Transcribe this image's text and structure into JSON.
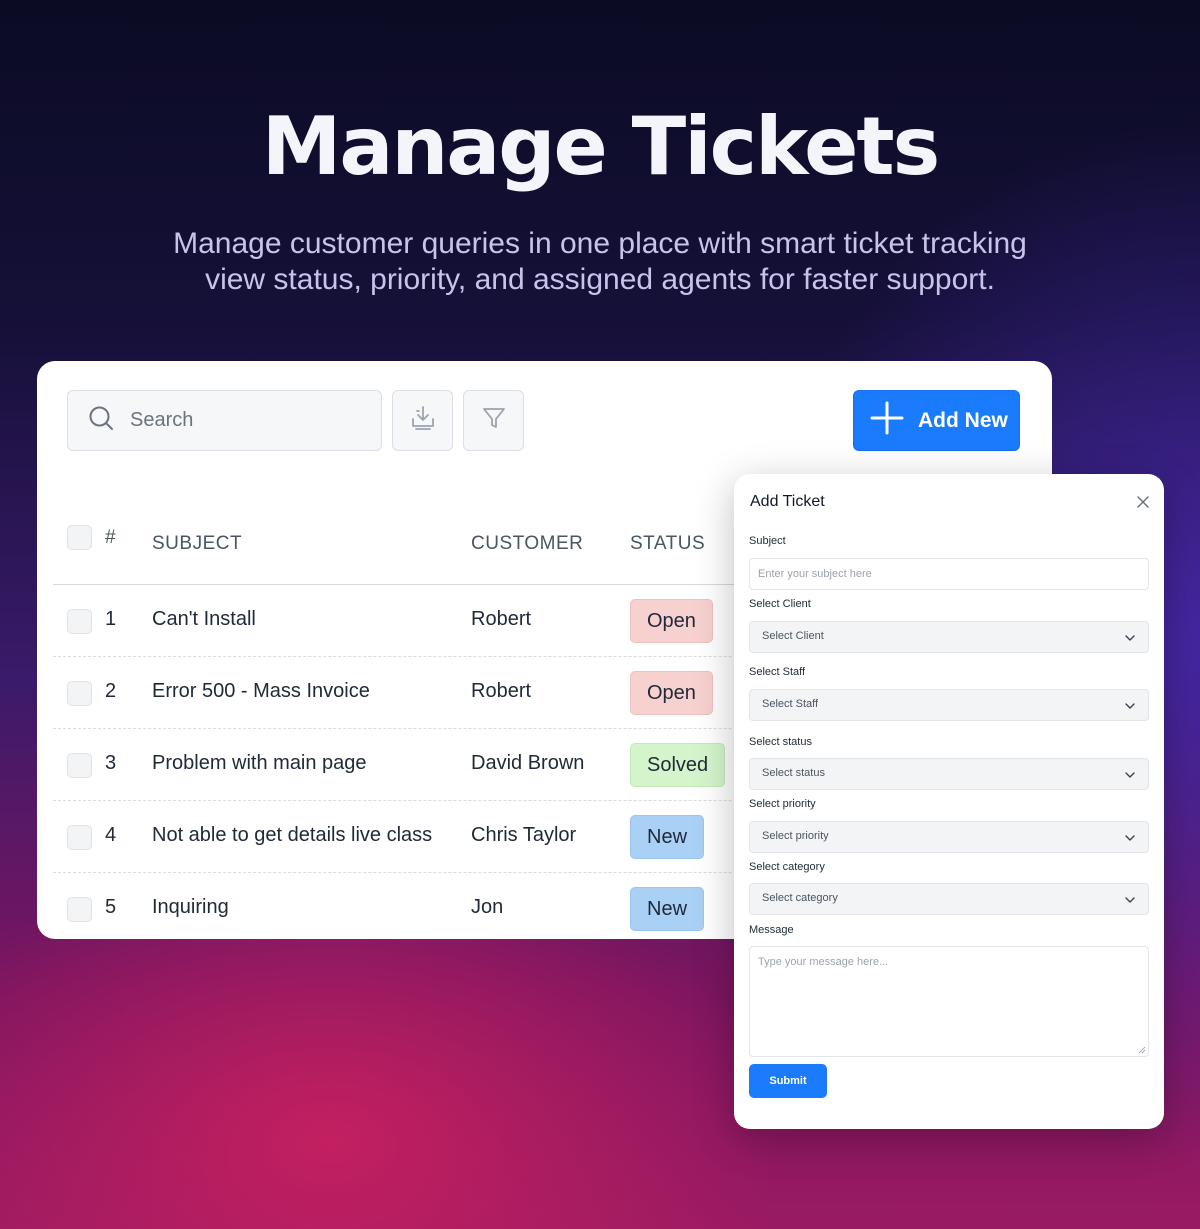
{
  "hero": {
    "title": "Manage Tickets",
    "subtitle_line1": "Manage customer queries in one place with smart ticket tracking",
    "subtitle_line2": "view status, priority, and assigned agents for faster support."
  },
  "toolbar": {
    "search_placeholder": "Search",
    "add_new_label": "Add New"
  },
  "table": {
    "headers": {
      "number": "#",
      "subject": "SUBJECT",
      "customer": "CUSTOMER",
      "status": "STATUS"
    },
    "rows": [
      {
        "number": "1",
        "subject": "Can't Install",
        "customer": "Robert",
        "status": "Open"
      },
      {
        "number": "2",
        "subject": "Error 500 - Mass Invoice",
        "customer": "Robert",
        "status": "Open"
      },
      {
        "number": "3",
        "subject": "Problem with main page",
        "customer": "David Brown",
        "status": "Solved"
      },
      {
        "number": "4",
        "subject": "Not able to get details live class",
        "customer": "Chris Taylor",
        "status": "New"
      },
      {
        "number": "5",
        "subject": "Inquiring",
        "customer": "Jon",
        "status": "New"
      }
    ]
  },
  "status_colors": {
    "Open": "#f7d0d0",
    "Solved": "#d4f5cc",
    "New": "#a9d0f5"
  },
  "accent_color": "#1a7bfd",
  "modal": {
    "title": "Add Ticket",
    "subject_label": "Subject",
    "subject_placeholder": "Enter your subject here",
    "client_label": "Select Client",
    "client_value": "Select Client",
    "staff_label": "Select Staff",
    "staff_value": "Select Staff",
    "status_label": "Select status",
    "status_value": "Select status",
    "priority_label": "Select priority",
    "priority_value": "Select priority",
    "category_label": "Select category",
    "category_value": "Select category",
    "message_label": "Message",
    "message_placeholder": "Type your message here...",
    "submit_label": "Submit"
  }
}
